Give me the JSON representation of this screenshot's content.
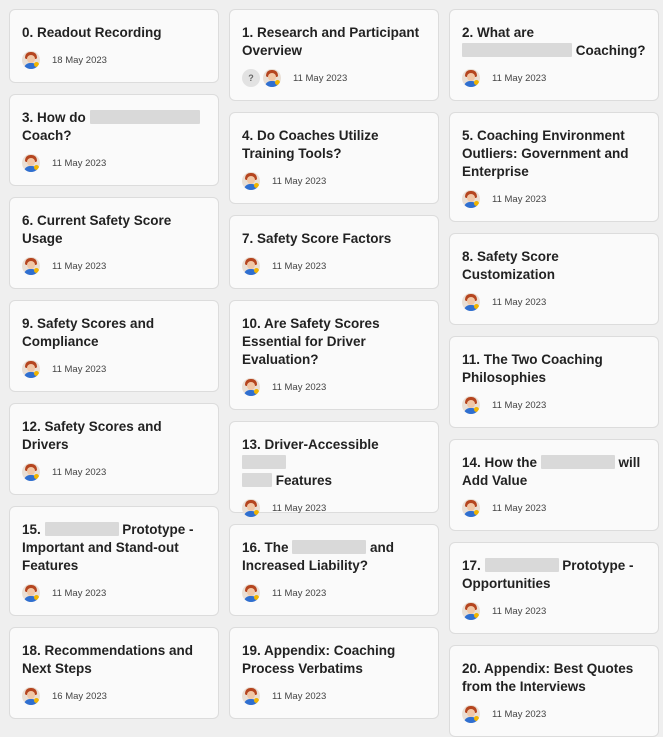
{
  "cards": [
    {
      "parts": [
        "0. Readout Recording"
      ],
      "date": "18 May 2023"
    },
    {
      "parts": [
        "1. Research and Participant Overview"
      ],
      "date": "11 May 2023",
      "unknown": "?"
    },
    {
      "parts": [
        "2. What are ",
        "",
        "Coaching?"
      ],
      "date": "11 May 2023"
    },
    {
      "parts": [
        "3. How do ",
        "",
        "Coach?"
      ],
      "date": "11 May 2023"
    },
    {
      "parts": [
        "4. Do Coaches Utilize Training Tools?"
      ],
      "date": "11 May 2023"
    },
    {
      "parts": [
        "5. Coaching Environment Outliers: Government and Enterprise"
      ],
      "date": "11 May 2023"
    },
    {
      "parts": [
        "6. Current Safety Score Usage"
      ],
      "date": "11 May 2023"
    },
    {
      "parts": [
        "7. Safety Score Factors"
      ],
      "date": "11 May 2023"
    },
    {
      "parts": [
        "8. Safety Score Customization"
      ],
      "date": "11 May 2023"
    },
    {
      "parts": [
        "9. Safety Scores and Compliance"
      ],
      "date": "11 May 2023"
    },
    {
      "parts": [
        "10. Are Safety Scores Essential for Driver Evaluation?"
      ],
      "date": "11 May 2023"
    },
    {
      "parts": [
        "11. The Two Coaching Philosophies"
      ],
      "date": "11 May 2023"
    },
    {
      "parts": [
        "12. Safety Scores and Drivers"
      ],
      "date": "11 May 2023"
    },
    {
      "parts": [
        "13. Driver-Accessible ",
        "",
        "Features"
      ],
      "date": "11 May 2023"
    },
    {
      "parts": [
        "14. How the ",
        "",
        "will Add Value"
      ],
      "date": "11 May 2023"
    },
    {
      "parts": [
        "15. ",
        "",
        "Prototype - Important and Stand-out Features"
      ],
      "date": "11 May 2023"
    },
    {
      "parts": [
        "16. The ",
        "",
        "and Increased Liability?"
      ],
      "date": "11 May 2023"
    },
    {
      "parts": [
        "17. ",
        "",
        "Prototype - Opportunities"
      ],
      "date": "11 May 2023"
    },
    {
      "parts": [
        "18. Recommendations and Next Steps"
      ],
      "date": "16 May 2023"
    },
    {
      "parts": [
        "19. Appendix: Coaching Process Verbatims"
      ],
      "date": "11 May 2023"
    },
    {
      "parts": [
        "20. Appendix: Best Quotes from the Interviews"
      ],
      "date": "11 May 2023"
    }
  ]
}
